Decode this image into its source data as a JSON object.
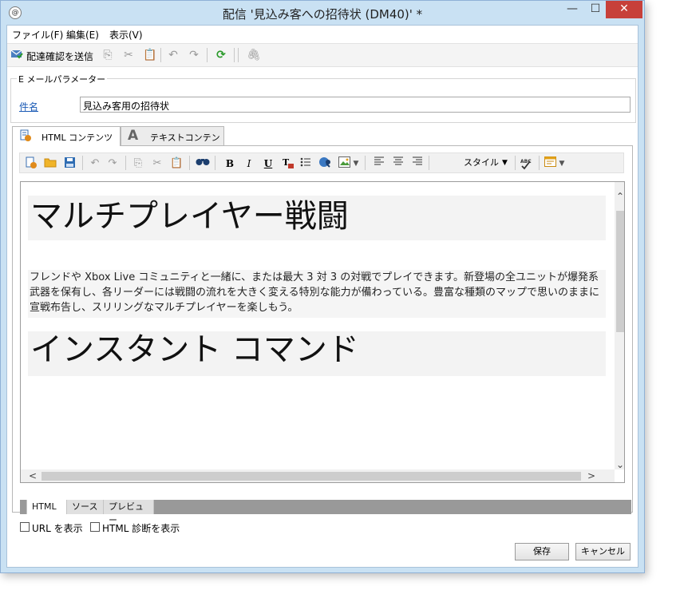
{
  "window": {
    "title": "配信 '見込み客への招待状 (DM40)' *",
    "app_icon": "@",
    "controls": {
      "minimize": "—",
      "maximize": "☐",
      "close": "✕"
    }
  },
  "menu": [
    {
      "label": "ファイル(F)"
    },
    {
      "label": "編集(E)"
    },
    {
      "label": "表示(V)"
    }
  ],
  "toolbar": {
    "send_proof_label": "配達確認を送信",
    "icons": [
      "send-proof-icon",
      "copy-icon",
      "cut-icon",
      "paste-icon",
      "undo-icon",
      "redo-icon",
      "refresh-icon",
      "attachment-icon"
    ]
  },
  "email_params": {
    "group_title": "E メールパラメーター",
    "subject_label": "件名",
    "subject_value": "見込み客用の招待状"
  },
  "content_tabs": [
    {
      "label": "HTML コンテンツ",
      "icon": "html-content-icon",
      "active": true
    },
    {
      "label": "テキストコンテンツ",
      "icon": "text-content-icon",
      "active": false
    }
  ],
  "editor_toolbar": {
    "style_label": "スタイル",
    "bold": "B",
    "italic": "I",
    "underline": "U",
    "spell_label": "ABC"
  },
  "editor_content": {
    "heading1": "マルチプレイヤー戦闘",
    "paragraph": "フレンドや Xbox Live コミュニティと一緒に、または最大 3 対 3 の対戦でプレイできます。新登場の全ユニットが爆発系武器を保有し、各リーダーには戦闘の流れを大きく変える特別な能力が備わっている。豊富な種類のマップで思いのままに宣戦布告し、スリリングなマルチプレイヤーを楽しもう。",
    "heading2": "インスタント コマンド"
  },
  "view_tabs": [
    {
      "label": "HTML",
      "active": true
    },
    {
      "label": "ソース",
      "active": false
    },
    {
      "label": "プレビュー",
      "active": false
    }
  ],
  "options": {
    "show_url": "URL を表示",
    "show_html_diag": "HTML 診断を表示"
  },
  "buttons": {
    "save": "保存",
    "cancel": "キャンセル"
  },
  "colors": {
    "window_frame": "#c9e1f3",
    "close_button": "#c7403a",
    "link_blue": "#1a5ab5",
    "view_tab_bar": "#999999"
  }
}
